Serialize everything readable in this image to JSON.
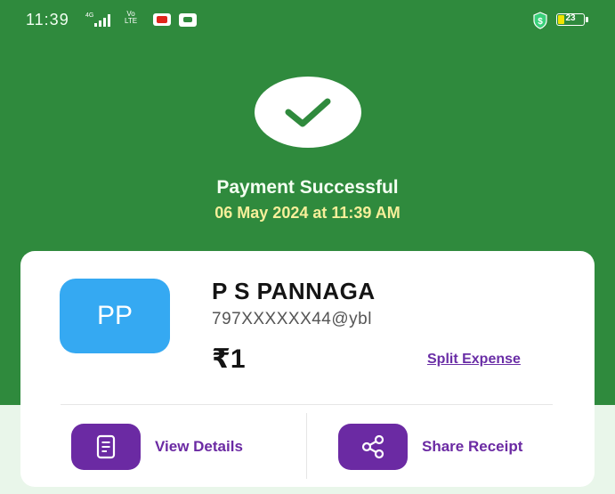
{
  "status_bar": {
    "time": "11:39",
    "network_tag": "4G",
    "volte_top": "Vo",
    "volte_bottom": "LTE",
    "battery_percent": "23",
    "battery_level": 0.23,
    "icons": [
      "signal-icon",
      "youtube-icon",
      "message-icon",
      "shield-icon",
      "battery-icon"
    ]
  },
  "payment": {
    "status_title": "Payment Successful",
    "datetime": "06 May 2024 at 11:39 AM"
  },
  "payee": {
    "initials": "PP",
    "name": "P S PANNAGA",
    "upi_id": "797XXXXXX44@ybl",
    "amount": "₹1",
    "split_label": "Split Expense"
  },
  "actions": {
    "view_details": "View Details",
    "share_receipt": "Share Receipt"
  },
  "colors": {
    "header_green": "#2f8a3d",
    "accent_purple": "#6b2aa3",
    "avatar_blue": "#35a9f2",
    "date_yellow": "#f7ef9a"
  }
}
